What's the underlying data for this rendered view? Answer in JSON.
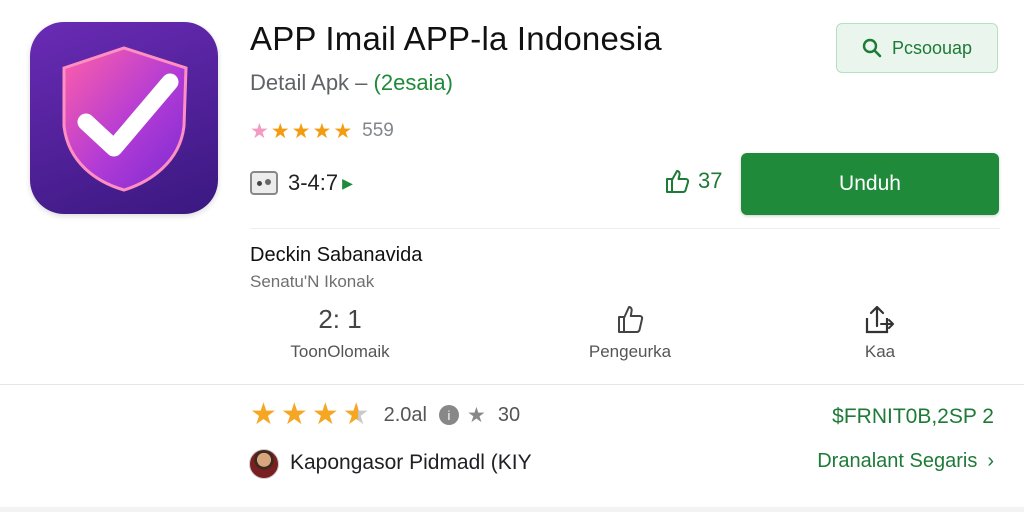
{
  "app": {
    "title": "APP Imail APP-la Indonesia",
    "subtitle_prefix": "Detail Apk – ",
    "subtitle_accent": "(2esaia)",
    "icon": "shield-check-icon"
  },
  "search": {
    "label": "Pcsoouap",
    "icon": "search-icon"
  },
  "rating": {
    "stars": 5,
    "count": "559"
  },
  "size": {
    "value": "3-4:7",
    "icon": "storage-icon"
  },
  "likes": {
    "count": "37",
    "icon": "thumbs-up-icon"
  },
  "download": {
    "label": "Unduh"
  },
  "developer": {
    "name": "Deckin Sabanavida",
    "subtitle": "Senatu'N Ikonak"
  },
  "stats": [
    {
      "value": "2: 1",
      "label": "ToonOlomaik"
    },
    {
      "icon": "share-icon",
      "label": "Pengeurka"
    },
    {
      "icon": "share-out-icon",
      "label": "Kaa"
    }
  ],
  "review": {
    "stars_value": 3.5,
    "rating_label": "2.0al",
    "info_icon": "info-icon",
    "count": "30",
    "price": "$FRNIT0B,2SP 2",
    "reviewer": "Kapongasor Pidmadl (KIY",
    "more_label": "Dranalant Segaris",
    "colors": {
      "accent": "#1e8a3a",
      "star": "#f5a623"
    }
  }
}
